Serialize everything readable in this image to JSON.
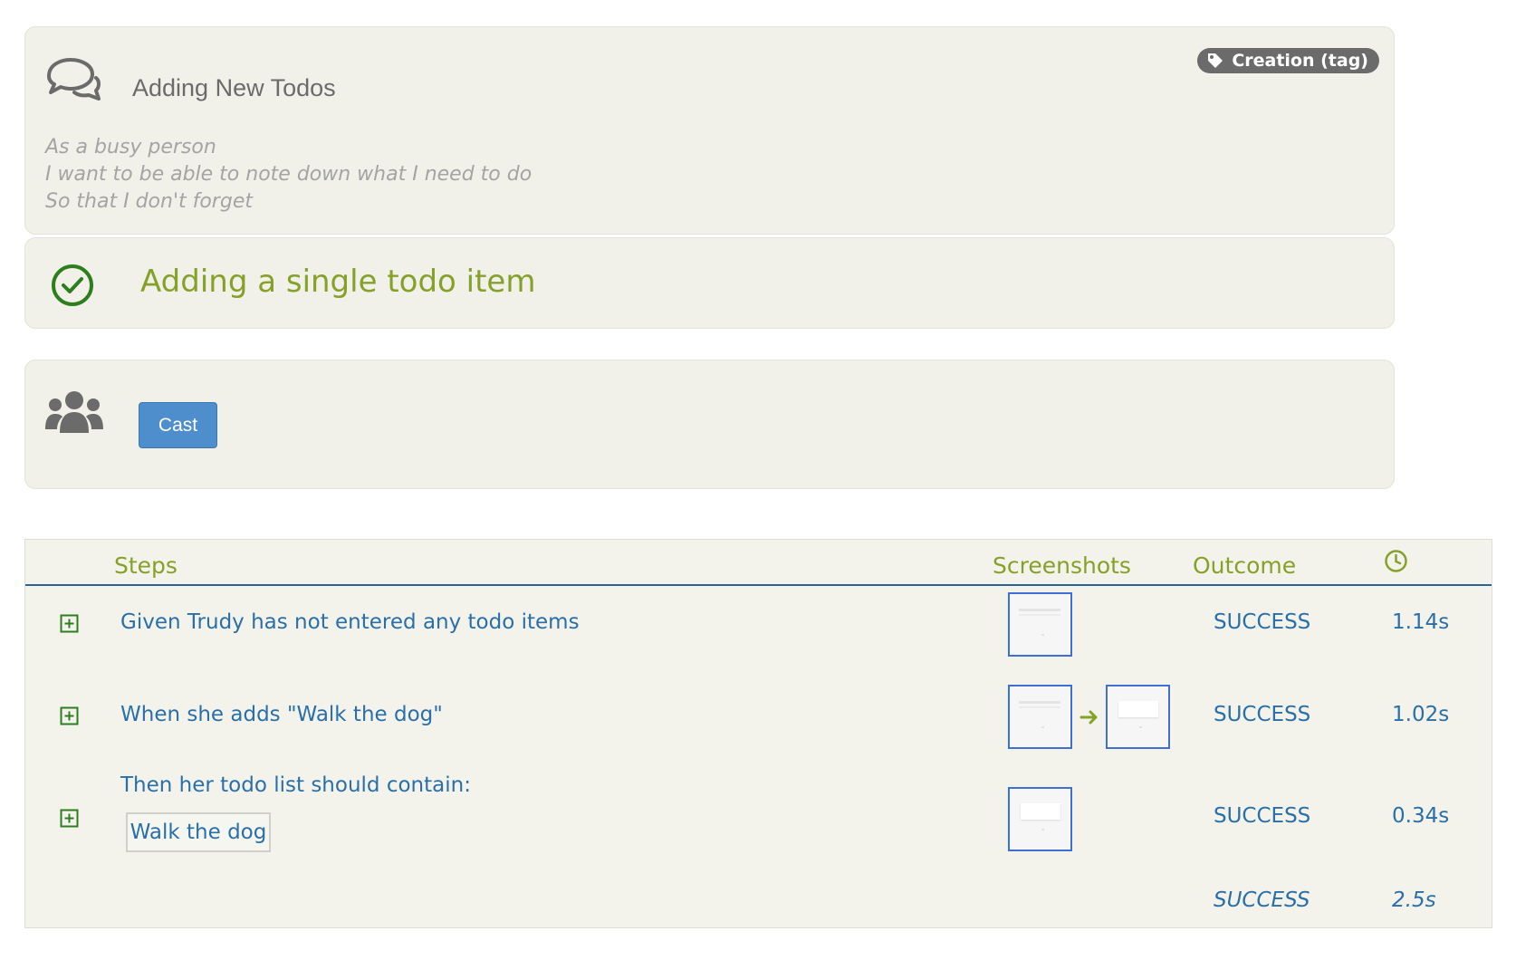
{
  "story": {
    "title": "Adding New Todos",
    "tag_label": "Creation (tag)",
    "narrative": [
      "As a busy person",
      "I want to be able to note down what I need to do",
      "So that I don't forget"
    ]
  },
  "scenario": {
    "title": "Adding a single todo item"
  },
  "cast": {
    "button_label": "Cast"
  },
  "steps_table": {
    "headers": {
      "steps": "Steps",
      "screenshots": "Screenshots",
      "outcome": "Outcome"
    },
    "rows": [
      {
        "text": "Given Trudy has not entered any todo items",
        "outcome": "SUCCESS",
        "duration": "1.14s"
      },
      {
        "text": "When she adds \"Walk the dog\"",
        "outcome": "SUCCESS",
        "duration": "1.02s"
      },
      {
        "text": "Then her todo list should contain:",
        "data_value": "Walk the dog",
        "outcome": "SUCCESS",
        "duration": "0.34s"
      }
    ],
    "summary": {
      "outcome": "SUCCESS",
      "duration": "2.5s"
    }
  },
  "colors": {
    "success_green": "#86a12a",
    "step_blue": "#2a6fa8",
    "button_blue": "#4f8ecd",
    "panel_bg": "#f1f1e9"
  },
  "icons": {
    "story": "comments-icon",
    "tag": "tag-icon",
    "scenario_status": "check-circle-icon",
    "cast": "users-icon",
    "duration_header": "clock-icon",
    "expand": "plus-square-icon",
    "transition": "arrow-right-icon"
  }
}
